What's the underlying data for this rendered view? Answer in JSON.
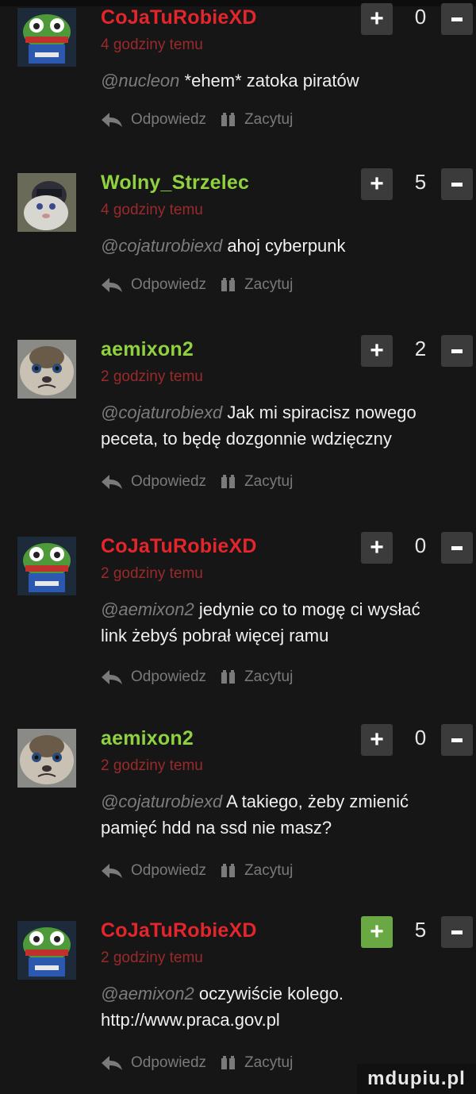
{
  "labels": {
    "reply": "Odpowiedz",
    "quote": "Zacytuj"
  },
  "colors": {
    "accent_green": "#8fd13f",
    "accent_red": "#e4262c",
    "time": "#9a2a2a",
    "vote_active": "#6aa843"
  },
  "comments": [
    {
      "user": "CoJaTuRobieXD",
      "user_color": "#e4262c",
      "time": "4 godziny temu",
      "score": "0",
      "mention": "@nucleon",
      "text_1": " *ehem* zatoka piratów",
      "text_2": "",
      "avatar": "frog-avatar"
    },
    {
      "user": "Wolny_Strzelec",
      "user_color": "#8fd13f",
      "time": "4 godziny temu",
      "score": "5",
      "mention": "@cojaturobiexd",
      "text_1": " ahoj cyberpunk",
      "text_2": "",
      "avatar": "cat-avatar"
    },
    {
      "user": "aemixon2",
      "user_color": "#8fd13f",
      "time": "2 godziny temu",
      "score": "2",
      "mention": "@cojaturobiexd",
      "text_1": " Jak mi spiracisz nowego",
      "text_2": "peceta, to będę dozgonnie wdzięczny",
      "avatar": "grumpy-cat-avatar"
    },
    {
      "user": "CoJaTuRobieXD",
      "user_color": "#e4262c",
      "time": "2 godziny temu",
      "score": "0",
      "mention": "@aemixon2",
      "text_1": " jedynie co to mogę ci wysłać",
      "text_2": "link żebyś pobrał więcej ramu",
      "avatar": "frog-avatar"
    },
    {
      "user": "aemixon2",
      "user_color": "#8fd13f",
      "time": "2 godziny temu",
      "score": "0",
      "mention": "@cojaturobiexd",
      "text_1": " A takiego, żeby zmienić",
      "text_2": "pamięć hdd na ssd nie masz?",
      "avatar": "grumpy-cat-avatar"
    },
    {
      "user": "CoJaTuRobieXD",
      "user_color": "#e4262c",
      "time": "2 godziny temu",
      "score": "5",
      "mention": "@aemixon2",
      "text_1": " oczywiście kolego.",
      "text_2": "http://www.praca.gov.pl",
      "avatar": "frog-avatar"
    }
  ],
  "watermark": "mdupiu.pl"
}
